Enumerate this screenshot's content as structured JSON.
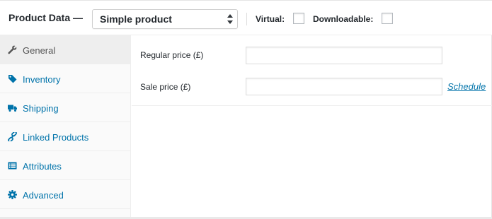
{
  "header": {
    "title": "Product Data —",
    "product_type": {
      "selected": "Simple product",
      "options": [
        "Simple product"
      ]
    },
    "virtual_label": "Virtual:",
    "downloadable_label": "Downloadable:"
  },
  "sidebar": {
    "items": [
      {
        "label": "General",
        "icon": "wrench-icon",
        "active": true
      },
      {
        "label": "Inventory",
        "icon": "tag-icon",
        "active": false
      },
      {
        "label": "Shipping",
        "icon": "truck-icon",
        "active": false
      },
      {
        "label": "Linked Products",
        "icon": "link-icon",
        "active": false
      },
      {
        "label": "Attributes",
        "icon": "list-icon",
        "active": false
      },
      {
        "label": "Advanced",
        "icon": "gear-icon",
        "active": false
      }
    ]
  },
  "general": {
    "regular_price_label": "Regular price (£)",
    "regular_price_value": "",
    "sale_price_label": "Sale price (£)",
    "sale_price_value": "",
    "schedule_link": "Schedule"
  },
  "colors": {
    "link": "#0073aa",
    "active_tab_bg": "#eeeeee",
    "sidebar_bg": "#fafafa"
  }
}
